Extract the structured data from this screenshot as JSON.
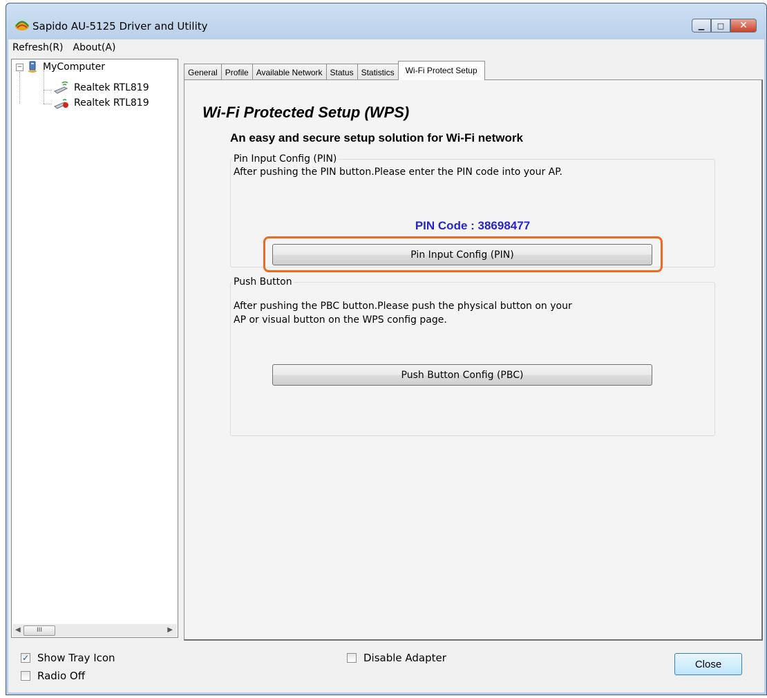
{
  "window": {
    "title": "Sapido AU-5125 Driver and Utility",
    "minimize_glyph": "▁",
    "maximize_glyph": "□",
    "close_glyph": "✕"
  },
  "menu": [
    "Refresh(R)",
    "About(A)"
  ],
  "tree": {
    "root": "MyComputer",
    "expander": "−",
    "adapters": [
      "Realtek RTL819",
      "Realtek RTL819"
    ],
    "scroll_thumb": "III"
  },
  "tabs": [
    "General",
    "Profile",
    "Available Network",
    "Status",
    "Statistics",
    "Wi-Fi Protect Setup"
  ],
  "active_tab": "Wi-Fi Protect Setup",
  "wps": {
    "title": "Wi-Fi Protected Setup (WPS)",
    "subtitle": "An easy and secure setup solution for Wi-Fi network",
    "pin_group": {
      "label": "Pin Input Config (PIN)",
      "description": "After pushing the PIN button.Please enter the PIN code into your AP.",
      "pin_code": "PIN Code :  38698477",
      "button": "Pin Input Config (PIN)"
    },
    "pbc_group": {
      "label": "Push Button",
      "description_line1": "After pushing the PBC button.Please push the physical button on your",
      "description_line2": "AP or visual button on the WPS config page.",
      "button": "Push Button Config (PBC)"
    }
  },
  "bottom": {
    "show_tray_icon": {
      "label": "Show Tray Icon",
      "checked": true
    },
    "radio_off": {
      "label": "Radio Off",
      "checked": false
    },
    "disable_adapter": {
      "label": "Disable Adapter",
      "checked": false
    },
    "close_button": "Close"
  },
  "colors": {
    "pin_code": "#2626c8",
    "highlight": "#ed6a1e"
  }
}
